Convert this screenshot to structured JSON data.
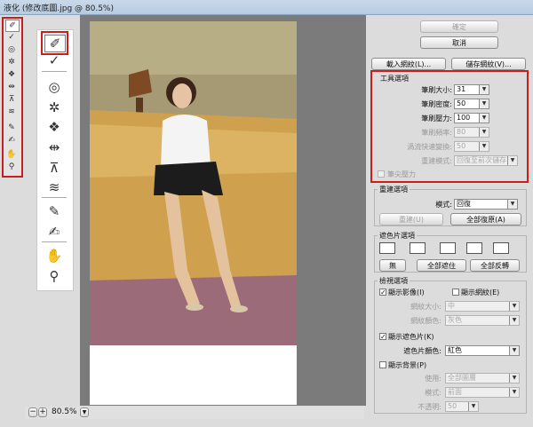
{
  "window_title": "液化 (修改底圖.jpg @ 80.5%)",
  "left_tools": [
    "wand-forward-icon",
    "reconstruct-icon",
    "twirl-icon",
    "pucker-icon",
    "bloat-icon",
    "push-left-icon",
    "mirror-icon",
    "turbulence-icon",
    "freeze-mask-icon",
    "thaw-mask-icon",
    "hand-icon",
    "zoom-icon"
  ],
  "status": {
    "zoom": "80.5%"
  },
  "buttons": {
    "ok": "確定",
    "cancel": "取消",
    "load_mesh": "載入網紋(L)...",
    "save_mesh": "儲存網紋(V)..."
  },
  "tool_options": {
    "title": "工具選項",
    "brush_size_label": "筆刷大小:",
    "brush_size": "31",
    "brush_density_label": "筆刷密度:",
    "brush_density": "50",
    "brush_pressure_label": "筆刷壓力:",
    "brush_pressure": "100",
    "brush_rate_label": "筆刷頻率:",
    "brush_rate": "80",
    "turbulent_jitter_label": "渦流快速變換:",
    "turbulent_jitter": "50",
    "reconstruct_mode_label": "重建模式:",
    "reconstruct_mode": "回復至前次儲存",
    "stylus_pressure": "筆尖壓力"
  },
  "reconstruct_options": {
    "title": "重建選項",
    "mode_label": "模式:",
    "mode": "回復",
    "reconstruct_btn": "重建(U)",
    "restore_all_btn": "全部復原(A)"
  },
  "mask_options": {
    "title": "遮色片選項",
    "none_btn": "無",
    "mask_all_btn": "全部遮住",
    "invert_all_btn": "全部反轉"
  },
  "view_options": {
    "title": "檢視選項",
    "show_image": "顯示影像(I)",
    "show_mesh": "顯示網紋(E)",
    "mesh_size_label": "網紋大小:",
    "mesh_size": "中",
    "mesh_color_label": "網紋顏色:",
    "mesh_color": "灰色",
    "show_mask": "顯示遮色片(K)",
    "mask_color_label": "遮色片顏色:",
    "mask_color": "紅色",
    "show_backdrop": "顯示背景(P)",
    "use_label": "使用:",
    "use": "全部圖層",
    "mode_label": "模式:",
    "mode": "前面",
    "opacity_label": "不透明:",
    "opacity": "50"
  }
}
